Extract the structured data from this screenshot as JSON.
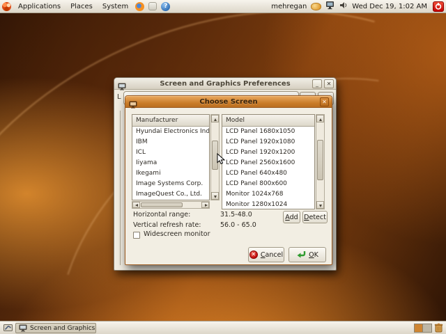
{
  "top_panel": {
    "menus": [
      "Applications",
      "Places",
      "System"
    ],
    "username": "mehregan",
    "clock": "Wed Dec 19,  1:02 AM"
  },
  "outer_window": {
    "title": "Screen and Graphics Preferences",
    "minimize_glyph": "_",
    "close_glyph": "✕",
    "clipped_label": "L"
  },
  "dialog": {
    "title": "Choose Screen",
    "close_glyph": "✕",
    "manufacturer": {
      "header": "Manufacturer",
      "items": [
        "Hyundai Electronics Industri",
        "IBM",
        "ICL",
        "Iiyama",
        "Ikegami",
        "Image Systems Corp.",
        "ImageQuest Co., Ltd."
      ]
    },
    "model": {
      "header": "Model",
      "items": [
        "LCD Panel 1680x1050",
        "LCD Panel 1920x1080",
        "LCD Panel 1920x1200",
        "LCD Panel 2560x1600",
        "LCD Panel 640x480",
        "LCD Panel 800x600",
        "Monitor 1024x768",
        "Monitor 1280x1024"
      ]
    },
    "horizontal_range_label": "Horizontal range:",
    "horizontal_range_value": "31.5-48.0",
    "vertical_refresh_label": "Vertical refresh rate:",
    "vertical_refresh_value": "56.0 - 65.0",
    "widescreen_label": "Widescreen monitor",
    "add_label": "Add",
    "detect_label": "Detect",
    "cancel_label": "Cancel",
    "cancel_icon_glyph": "✕",
    "ok_label": "OK"
  },
  "bottom_panel": {
    "task_label": "Screen and Graphics..."
  },
  "colors": {
    "titlebar_accent": "#c87b28",
    "panel_bg": "#e8e3d6",
    "desktop_base": "#8a4510",
    "quit_button_red": "#c40000"
  }
}
